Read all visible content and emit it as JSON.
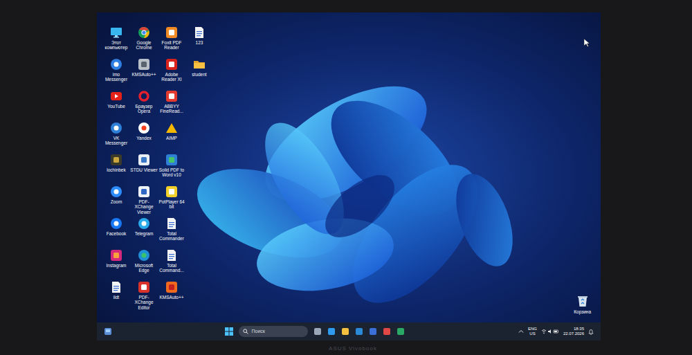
{
  "desktop": {
    "columns": [
      {
        "icons": [
          {
            "label": "Этот компьютер"
          },
          {
            "label": "imo Messenger"
          },
          {
            "label": "YouTube"
          },
          {
            "label": "VK Messenger"
          },
          {
            "label": "lochinbek"
          },
          {
            "label": "Zoom"
          },
          {
            "label": "Facebook"
          },
          {
            "label": "Instagram"
          },
          {
            "label": "ildt"
          }
        ]
      },
      {
        "icons": [
          {
            "label": "Google Chrome"
          },
          {
            "label": "KMSAuto++"
          },
          {
            "label": "Браузер Opera"
          },
          {
            "label": "Yandex"
          },
          {
            "label": "STDU Viewer"
          },
          {
            "label": "PDF-XChange Viewer"
          },
          {
            "label": "Telegram"
          },
          {
            "label": "Microsoft Edge"
          },
          {
            "label": "PDF-XChange Editor"
          }
        ]
      },
      {
        "icons": [
          {
            "label": "Foxit PDF Reader"
          },
          {
            "label": "Adobe Reader XI"
          },
          {
            "label": "ABBYY FineRead..."
          },
          {
            "label": "AIMP"
          },
          {
            "label": "Solid PDF to Word v10"
          },
          {
            "label": "PotPlayer 64 bit"
          },
          {
            "label": "Total Commander"
          },
          {
            "label": "Total Command..."
          },
          {
            "label": "KMSAuto++"
          }
        ]
      },
      {
        "icons": [
          {
            "label": "123"
          },
          {
            "label": "student"
          }
        ]
      }
    ]
  },
  "recycle_bin": {
    "label": "Корзина"
  },
  "taskbar": {
    "search": {
      "placeholder": "Поиск"
    },
    "language": {
      "code": "ENG",
      "region": "US"
    },
    "clock": {
      "time": "18:35",
      "date": "22.07.2026"
    }
  },
  "bezel": {
    "brand": "ASUS Vivobook"
  }
}
